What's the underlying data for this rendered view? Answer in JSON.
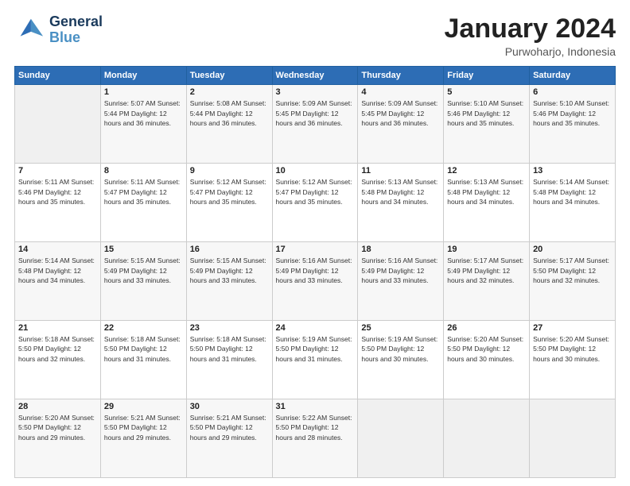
{
  "header": {
    "logo": {
      "line1": "General",
      "line2": "Blue"
    },
    "title": "January 2024",
    "location": "Purwoharjo, Indonesia"
  },
  "days_of_week": [
    "Sunday",
    "Monday",
    "Tuesday",
    "Wednesday",
    "Thursday",
    "Friday",
    "Saturday"
  ],
  "weeks": [
    [
      {
        "day": "",
        "info": ""
      },
      {
        "day": "1",
        "info": "Sunrise: 5:07 AM\nSunset: 5:44 PM\nDaylight: 12 hours\nand 36 minutes."
      },
      {
        "day": "2",
        "info": "Sunrise: 5:08 AM\nSunset: 5:44 PM\nDaylight: 12 hours\nand 36 minutes."
      },
      {
        "day": "3",
        "info": "Sunrise: 5:09 AM\nSunset: 5:45 PM\nDaylight: 12 hours\nand 36 minutes."
      },
      {
        "day": "4",
        "info": "Sunrise: 5:09 AM\nSunset: 5:45 PM\nDaylight: 12 hours\nand 36 minutes."
      },
      {
        "day": "5",
        "info": "Sunrise: 5:10 AM\nSunset: 5:46 PM\nDaylight: 12 hours\nand 35 minutes."
      },
      {
        "day": "6",
        "info": "Sunrise: 5:10 AM\nSunset: 5:46 PM\nDaylight: 12 hours\nand 35 minutes."
      }
    ],
    [
      {
        "day": "7",
        "info": "Sunrise: 5:11 AM\nSunset: 5:46 PM\nDaylight: 12 hours\nand 35 minutes."
      },
      {
        "day": "8",
        "info": "Sunrise: 5:11 AM\nSunset: 5:47 PM\nDaylight: 12 hours\nand 35 minutes."
      },
      {
        "day": "9",
        "info": "Sunrise: 5:12 AM\nSunset: 5:47 PM\nDaylight: 12 hours\nand 35 minutes."
      },
      {
        "day": "10",
        "info": "Sunrise: 5:12 AM\nSunset: 5:47 PM\nDaylight: 12 hours\nand 35 minutes."
      },
      {
        "day": "11",
        "info": "Sunrise: 5:13 AM\nSunset: 5:48 PM\nDaylight: 12 hours\nand 34 minutes."
      },
      {
        "day": "12",
        "info": "Sunrise: 5:13 AM\nSunset: 5:48 PM\nDaylight: 12 hours\nand 34 minutes."
      },
      {
        "day": "13",
        "info": "Sunrise: 5:14 AM\nSunset: 5:48 PM\nDaylight: 12 hours\nand 34 minutes."
      }
    ],
    [
      {
        "day": "14",
        "info": "Sunrise: 5:14 AM\nSunset: 5:48 PM\nDaylight: 12 hours\nand 34 minutes."
      },
      {
        "day": "15",
        "info": "Sunrise: 5:15 AM\nSunset: 5:49 PM\nDaylight: 12 hours\nand 33 minutes."
      },
      {
        "day": "16",
        "info": "Sunrise: 5:15 AM\nSunset: 5:49 PM\nDaylight: 12 hours\nand 33 minutes."
      },
      {
        "day": "17",
        "info": "Sunrise: 5:16 AM\nSunset: 5:49 PM\nDaylight: 12 hours\nand 33 minutes."
      },
      {
        "day": "18",
        "info": "Sunrise: 5:16 AM\nSunset: 5:49 PM\nDaylight: 12 hours\nand 33 minutes."
      },
      {
        "day": "19",
        "info": "Sunrise: 5:17 AM\nSunset: 5:49 PM\nDaylight: 12 hours\nand 32 minutes."
      },
      {
        "day": "20",
        "info": "Sunrise: 5:17 AM\nSunset: 5:50 PM\nDaylight: 12 hours\nand 32 minutes."
      }
    ],
    [
      {
        "day": "21",
        "info": "Sunrise: 5:18 AM\nSunset: 5:50 PM\nDaylight: 12 hours\nand 32 minutes."
      },
      {
        "day": "22",
        "info": "Sunrise: 5:18 AM\nSunset: 5:50 PM\nDaylight: 12 hours\nand 31 minutes."
      },
      {
        "day": "23",
        "info": "Sunrise: 5:18 AM\nSunset: 5:50 PM\nDaylight: 12 hours\nand 31 minutes."
      },
      {
        "day": "24",
        "info": "Sunrise: 5:19 AM\nSunset: 5:50 PM\nDaylight: 12 hours\nand 31 minutes."
      },
      {
        "day": "25",
        "info": "Sunrise: 5:19 AM\nSunset: 5:50 PM\nDaylight: 12 hours\nand 30 minutes."
      },
      {
        "day": "26",
        "info": "Sunrise: 5:20 AM\nSunset: 5:50 PM\nDaylight: 12 hours\nand 30 minutes."
      },
      {
        "day": "27",
        "info": "Sunrise: 5:20 AM\nSunset: 5:50 PM\nDaylight: 12 hours\nand 30 minutes."
      }
    ],
    [
      {
        "day": "28",
        "info": "Sunrise: 5:20 AM\nSunset: 5:50 PM\nDaylight: 12 hours\nand 29 minutes."
      },
      {
        "day": "29",
        "info": "Sunrise: 5:21 AM\nSunset: 5:50 PM\nDaylight: 12 hours\nand 29 minutes."
      },
      {
        "day": "30",
        "info": "Sunrise: 5:21 AM\nSunset: 5:50 PM\nDaylight: 12 hours\nand 29 minutes."
      },
      {
        "day": "31",
        "info": "Sunrise: 5:22 AM\nSunset: 5:50 PM\nDaylight: 12 hours\nand 28 minutes."
      },
      {
        "day": "",
        "info": ""
      },
      {
        "day": "",
        "info": ""
      },
      {
        "day": "",
        "info": ""
      }
    ]
  ]
}
